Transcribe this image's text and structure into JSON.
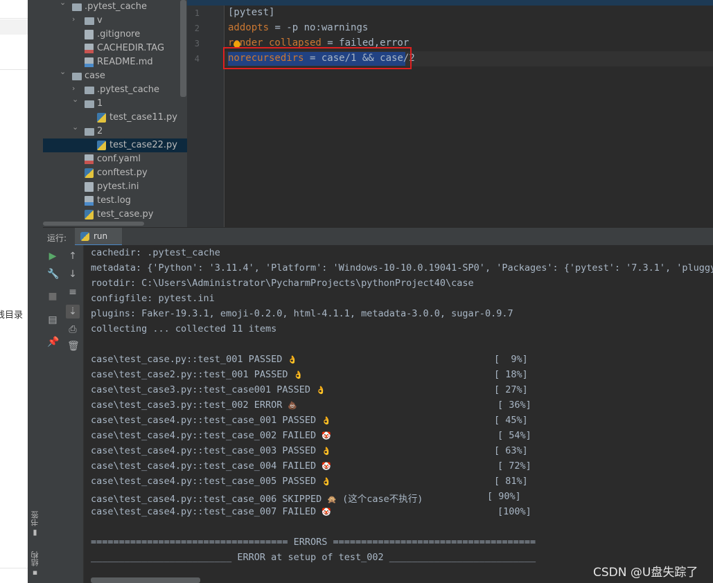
{
  "browser_strip": {
    "text": "线目录"
  },
  "side_tabs": {
    "bookmarks": "书签",
    "structure": "结构"
  },
  "project_tree": [
    {
      "indent": 1,
      "arrow": "down",
      "icon": "folder-icon",
      "label": ".pytest_cache"
    },
    {
      "indent": 2,
      "arrow": "right",
      "icon": "folder-icon",
      "label": "v"
    },
    {
      "indent": 2,
      "arrow": "",
      "icon": "file-icon",
      "label": ".gitignore"
    },
    {
      "indent": 2,
      "arrow": "",
      "icon": "tag-icon",
      "label": "CACHEDIR.TAG"
    },
    {
      "indent": 2,
      "arrow": "",
      "icon": "md-icon",
      "label": "README.md"
    },
    {
      "indent": 1,
      "arrow": "down",
      "icon": "folder-icon",
      "label": "case"
    },
    {
      "indent": 2,
      "arrow": "right",
      "icon": "folder-icon",
      "label": ".pytest_cache"
    },
    {
      "indent": 2,
      "arrow": "down",
      "icon": "folder-icon",
      "label": "1"
    },
    {
      "indent": 3,
      "arrow": "",
      "icon": "python-file-icon",
      "label": "test_case11.py"
    },
    {
      "indent": 2,
      "arrow": "down",
      "icon": "folder-icon",
      "label": "2"
    },
    {
      "indent": 3,
      "arrow": "",
      "icon": "python-file-icon",
      "label": "test_case22.py",
      "selected": true
    },
    {
      "indent": 2,
      "arrow": "",
      "icon": "yaml-icon",
      "label": "conf.yaml"
    },
    {
      "indent": 2,
      "arrow": "",
      "icon": "python-file-icon",
      "label": "conftest.py"
    },
    {
      "indent": 2,
      "arrow": "",
      "icon": "file-icon",
      "label": "pytest.ini"
    },
    {
      "indent": 2,
      "arrow": "",
      "icon": "log-icon",
      "label": "test.log"
    },
    {
      "indent": 2,
      "arrow": "",
      "icon": "python-file-icon",
      "label": "test_case.py"
    }
  ],
  "editor": {
    "line_numbers": [
      "1",
      "2",
      "3",
      "4"
    ],
    "lines": [
      {
        "key": "",
        "rest": "[pytest]"
      },
      {
        "key": "addopts",
        "rest": " = -p no:warnings"
      },
      {
        "key": "render_collapsed",
        "rest": " = failed,error"
      },
      {
        "key": "norecursedirs",
        "rest": " = case/1 && case/2"
      }
    ]
  },
  "run_window": {
    "label": "运行:",
    "tab_label": "run"
  },
  "console": {
    "header_lines": [
      "cachedir: .pytest_cache",
      "metadata: {'Python': '3.11.4', 'Platform': 'Windows-10-10.0.19041-SP0', 'Packages': {'pytest': '7.3.1', 'pluggy'",
      "rootdir: C:\\Users\\Administrator\\PycharmProjects\\pythonProject40\\case",
      "configfile: pytest.ini",
      "plugins: Faker-19.3.1, emoji-0.2.0, html-4.1.1, metadata-3.0.0, sugar-0.9.7",
      "collecting ... collected 11 items"
    ],
    "results": [
      {
        "text": "case\\test_case.py::test_001 PASSED",
        "emoji": "👌",
        "kind": "ok",
        "note": "",
        "percent": "[  9%]",
        "pct_left": 592
      },
      {
        "text": "case\\test_case2.py::test_001 PASSED",
        "emoji": "👌",
        "kind": "ok",
        "note": "",
        "percent": "[ 18%]",
        "pct_left": 592
      },
      {
        "text": "case\\test_case3.py::test_case001 PASSED",
        "emoji": "👌",
        "kind": "ok",
        "note": "",
        "percent": "[ 27%]",
        "pct_left": 592
      },
      {
        "text": "case\\test_case3.py::test_002 ERROR",
        "emoji": "💩",
        "kind": "err",
        "note": "",
        "percent": "[ 36%]",
        "pct_left": 597
      },
      {
        "text": "case\\test_case4.py::test_case_001 PASSED",
        "emoji": "👌",
        "kind": "ok",
        "note": "",
        "percent": "[ 45%]",
        "pct_left": 592
      },
      {
        "text": "case\\test_case4.py::test_case_002 FAILED",
        "emoji": "🤡",
        "kind": "fail",
        "note": "",
        "percent": "[ 54%]",
        "pct_left": 597
      },
      {
        "text": "case\\test_case4.py::test_case_003 PASSED",
        "emoji": "👌",
        "kind": "ok",
        "note": "",
        "percent": "[ 63%]",
        "pct_left": 592
      },
      {
        "text": "case\\test_case4.py::test_case_004 FAILED",
        "emoji": "🤡",
        "kind": "fail",
        "note": "",
        "percent": "[ 72%]",
        "pct_left": 597
      },
      {
        "text": "case\\test_case4.py::test_case_005 PASSED",
        "emoji": "👌",
        "kind": "ok",
        "note": "",
        "percent": "[ 81%]",
        "pct_left": 592
      },
      {
        "text": "case\\test_case4.py::test_case_006 SKIPPED",
        "emoji": "🙊",
        "kind": "skip",
        "note": " (这个case不执行)",
        "percent": "[ 90%]",
        "pct_left": 582
      },
      {
        "text": "case\\test_case4.py::test_case_007 FAILED",
        "emoji": "🤡",
        "kind": "fail",
        "note": "",
        "percent": "[100%]",
        "pct_left": 597
      }
    ],
    "errors_banner": "=================================== ERRORS ====================================",
    "error_setup": "_________________________ ERROR at setup of test_002 __________________________"
  },
  "watermark": "CSDN @U盘失踪了"
}
